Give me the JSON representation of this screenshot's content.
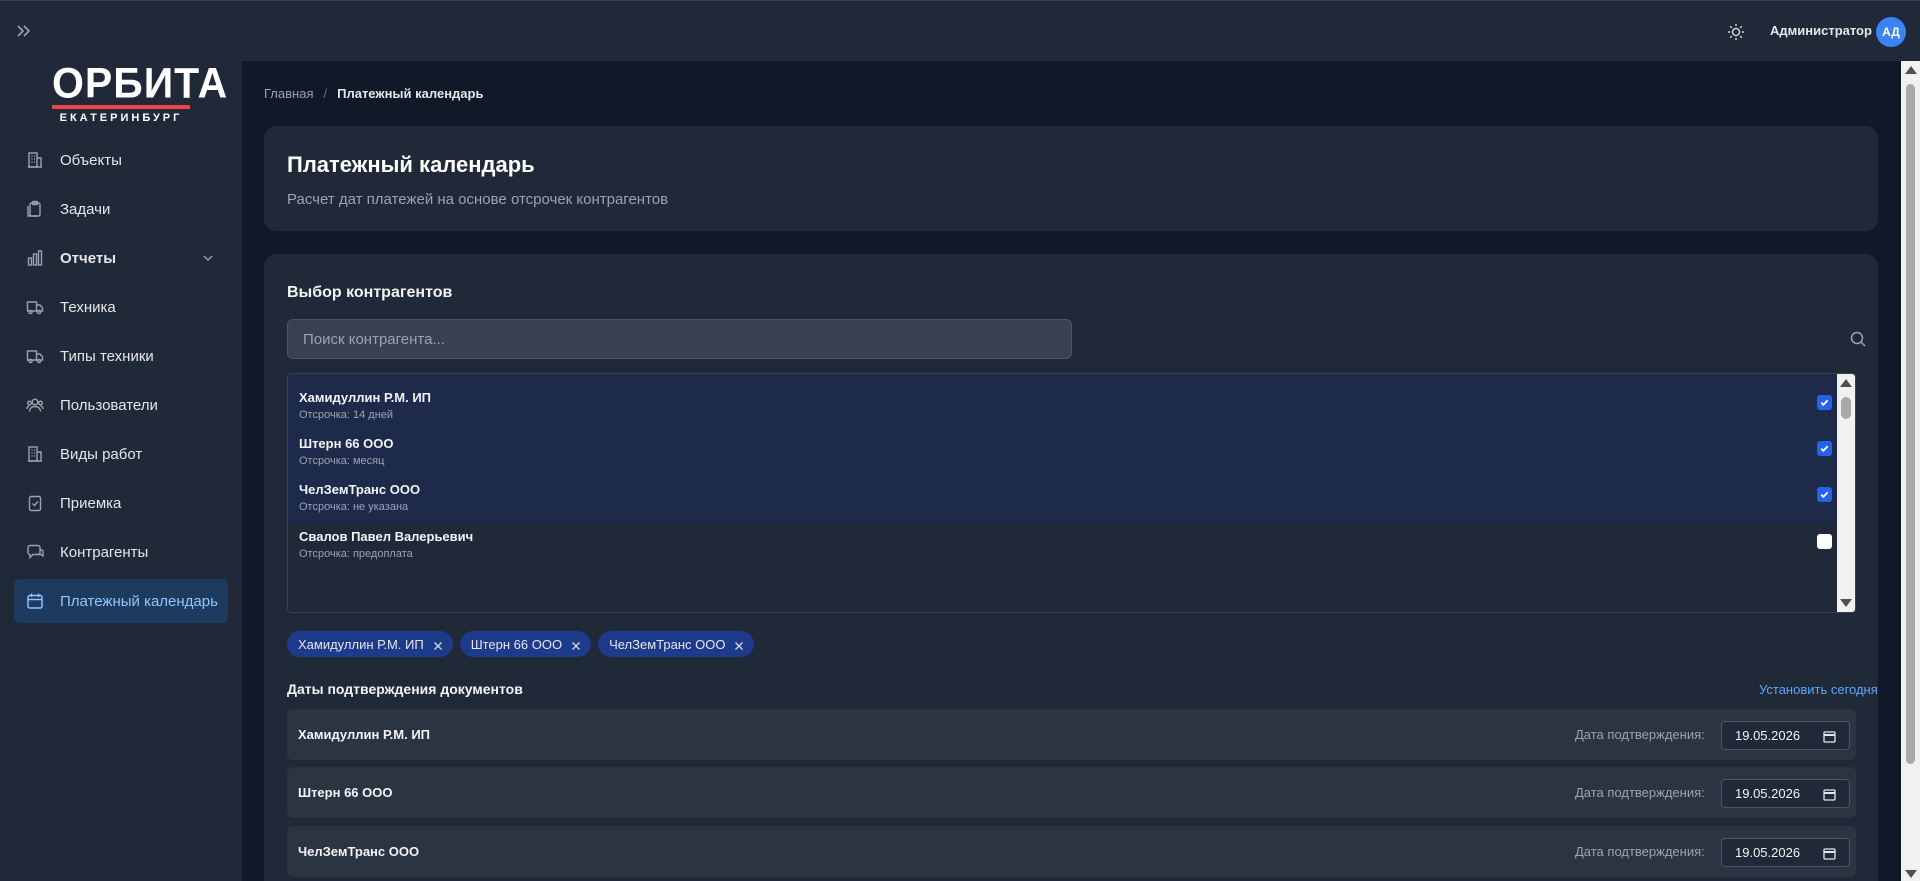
{
  "topbar": {
    "user_name": "Администратор",
    "avatar_initials": "АД"
  },
  "logo": {
    "main": "ОРБИТА",
    "sub": "ЕКАТЕРИНБУРГ"
  },
  "sidebar": {
    "items": [
      {
        "label": "Объекты",
        "icon": "building-icon"
      },
      {
        "label": "Задачи",
        "icon": "clipboard-icon"
      },
      {
        "label": "Отчеты",
        "icon": "bar-chart-icon",
        "expandable": true
      },
      {
        "label": "Техника",
        "icon": "truck-icon"
      },
      {
        "label": "Типы техники",
        "icon": "truck-icon"
      },
      {
        "label": "Пользователи",
        "icon": "users-icon"
      },
      {
        "label": "Виды работ",
        "icon": "building-icon"
      },
      {
        "label": "Приемка",
        "icon": "clipboard-check-icon"
      },
      {
        "label": "Контрагенты",
        "icon": "chat-icon"
      },
      {
        "label": "Платежный календарь",
        "icon": "calendar-icon",
        "active": true
      }
    ]
  },
  "breadcrumb": {
    "home": "Главная",
    "separator": "/",
    "current": "Платежный календарь"
  },
  "header": {
    "title": "Платежный календарь",
    "subtitle": "Расчет дат платежей на основе отсрочек контрагентов"
  },
  "selection": {
    "title": "Выбор контрагентов",
    "search_placeholder": "Поиск контрагента...",
    "items": [
      {
        "name": "Хамидуллин Р.М. ИП",
        "deferral": "Отсрочка: 14 дней",
        "checked": true
      },
      {
        "name": "Штерн 66 ООО",
        "deferral": "Отсрочка: месяц",
        "checked": true
      },
      {
        "name": "ЧелЗемТранс ООО",
        "deferral": "Отсрочка: не указана",
        "checked": true
      },
      {
        "name": "Свалов Павел Валерьевич",
        "deferral": "Отсрочка: предоплата",
        "checked": false
      }
    ],
    "chips": [
      "Хамидуллин Р.М. ИП",
      "Штерн 66 ООО",
      "ЧелЗемТранс ООО"
    ]
  },
  "dates": {
    "title": "Даты подтверждения документов",
    "set_today_label": "Установить сегодня",
    "date_label": "Дата подтверждения:",
    "rows": [
      {
        "name": "Хамидуллин Р.М. ИП",
        "date": "19.05.2026"
      },
      {
        "name": "Штерн 66 ООО",
        "date": "19.05.2026"
      },
      {
        "name": "ЧелЗемТранс ООО",
        "date": "19.05.2026"
      }
    ]
  },
  "colors": {
    "accent": "#2563eb",
    "link": "#60a5fa",
    "chip": "#1e3a8a",
    "logo_stripe": "#ef4444"
  }
}
